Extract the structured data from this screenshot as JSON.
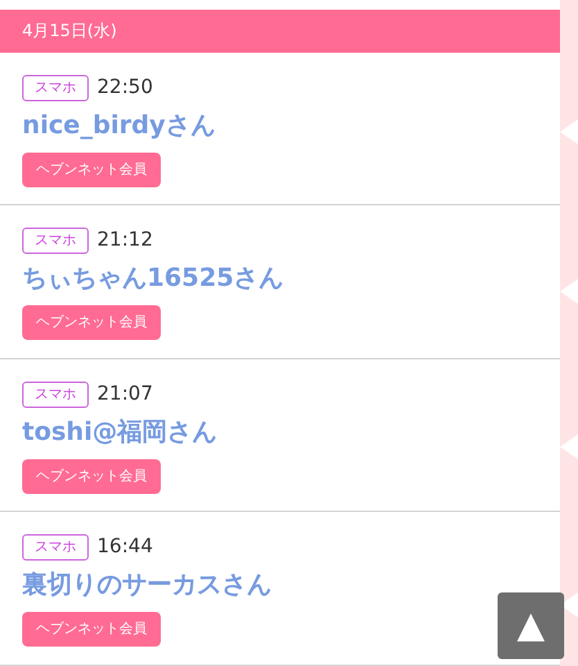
{
  "date_header": "4月15日(水)",
  "entries": [
    {
      "device": "スマホ",
      "time": "22:50",
      "name": "nice_birdyさん",
      "member": "ヘブンネット会員"
    },
    {
      "device": "スマホ",
      "time": "21:12",
      "name": "ちぃちゃん16525さん",
      "member": "ヘブンネット会員"
    },
    {
      "device": "スマホ",
      "time": "21:07",
      "name": "toshi@福岡さん",
      "member": "ヘブンネット会員"
    },
    {
      "device": "スマホ",
      "time": "16:44",
      "name": "裏切りのサーカスさん",
      "member": "ヘブンネット会員"
    }
  ],
  "back_to_top": "▲"
}
